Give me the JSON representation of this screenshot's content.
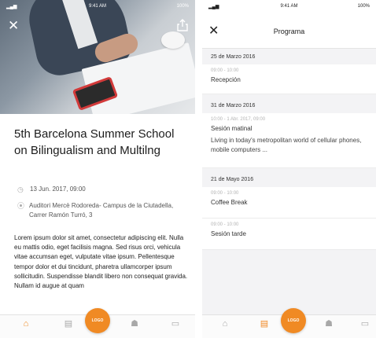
{
  "left": {
    "status": {
      "time": "9:41 AM",
      "battery": "100%"
    },
    "event": {
      "title": "5th Barcelona Summer School on Bilingualism and Multilng",
      "date": "13 Jun. 2017, 09:00",
      "location": "Auditori Mercè Rodoreda- Campus de la Ciutadella, Carrer Ramón Turró, 3",
      "description": "Lorem ipsum dolor sit amet, consectetur adipiscing elit. Nulla eu mattis odio, eget facilisis magna. Sed risus orci, vehicula vitae accumsan eget, vulputate vitae ipsum. Pellentesque tempor dolor et dui tincidunt, pharetra ullamcorper ipsum sollicitudin. Suspendisse blandit libero non consequat gravida. Nullam id augue at quam"
    },
    "icons": {
      "close": "close-icon",
      "share": "share-icon",
      "clock": "clock-icon",
      "pin": "location-pin-icon"
    }
  },
  "right": {
    "status": {
      "time": "9:41 AM",
      "battery": "100%"
    },
    "nav_title": "Programa",
    "sections": [
      {
        "date": "25 de Marzo 2016",
        "items": [
          {
            "time": "09:00 - 10:00",
            "name": "Recepción"
          }
        ]
      },
      {
        "date": "31 de Marzo 2016",
        "items": [
          {
            "time": "10:00 - 1 Abr. 2017, 09:00",
            "name": "Sesión matinal",
            "desc": "Living in today's metropolitan world of cellular phones, mobile computers ..."
          }
        ]
      },
      {
        "date": "21 de Mayo 2016",
        "items": [
          {
            "time": "09:00 - 10:00",
            "name": "Coffee Break"
          },
          {
            "time": "09:00 - 10:00",
            "name": "Sesión tarde"
          }
        ]
      }
    ]
  },
  "tabbar": {
    "accent": "#f08a24",
    "fab_label": "LOGO"
  }
}
